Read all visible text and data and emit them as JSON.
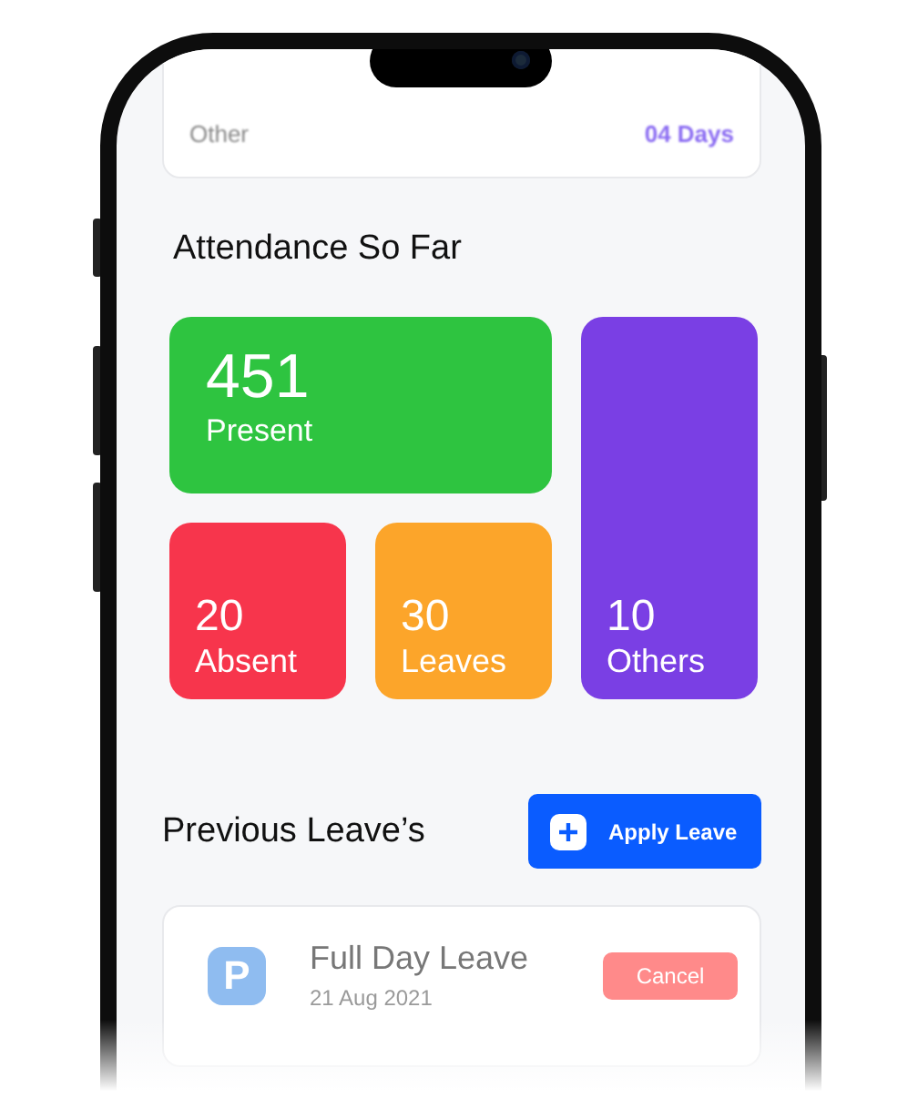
{
  "summary": [
    {
      "label": "Other",
      "value": "04 Days",
      "color": "#8b6cf2"
    }
  ],
  "attendance": {
    "title": "Attendance So Far",
    "stats": [
      {
        "value": "451",
        "label": "Present",
        "color": "#2ec440"
      },
      {
        "value": "20",
        "label": "Absent",
        "color": "#f7354c"
      },
      {
        "value": "30",
        "label": "Leaves",
        "color": "#fca52a"
      },
      {
        "value": "10",
        "label": "Others",
        "color": "#7a3fe4"
      }
    ]
  },
  "previous": {
    "title": "Previous Leave’s",
    "button": "Apply Leave",
    "items": [
      {
        "icon": "P",
        "title": "Full Day Leave",
        "date": "21 Aug 2021",
        "action": "Cancel"
      }
    ]
  }
}
